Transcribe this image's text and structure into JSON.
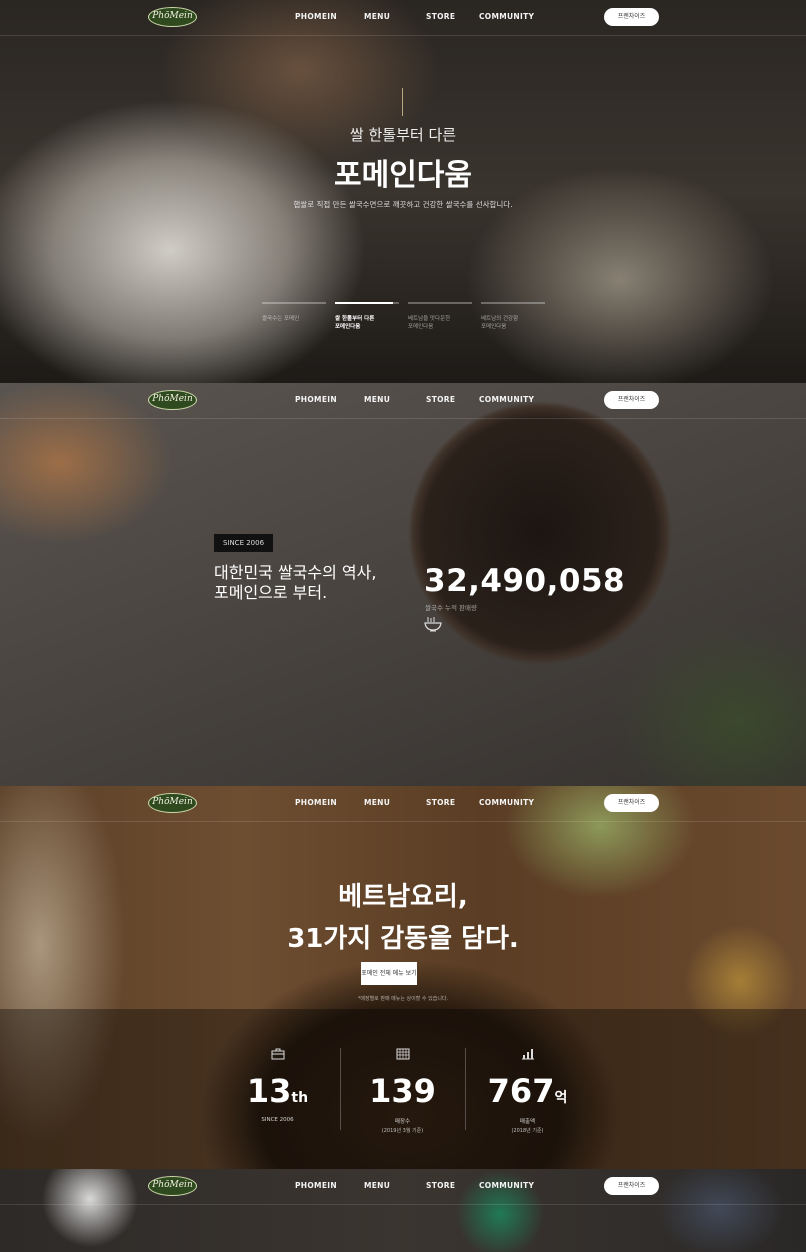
{
  "header": {
    "logo_text": "PhōMein",
    "nav": [
      "PHOMEIN",
      "MENU",
      "STORE",
      "COMMUNITY"
    ],
    "franchise_label": "프랜차이즈"
  },
  "hero": {
    "subtitle": "쌀 한톨부터 다른",
    "title": "포메인다움",
    "description": "햅쌀로 직접 만든 쌀국수면으로 깨끗하고 건강한 쌀국수를 선사합니다.",
    "tabs": [
      {
        "line1": "쌀국수는 포메인",
        "line2": "",
        "progress": 0
      },
      {
        "line1": "쌀 한톨부터 다른",
        "line2": "포메인다움",
        "progress": 0.9
      },
      {
        "line1": "베트남을 맛다운한",
        "line2": "포메인다움",
        "progress": 0
      },
      {
        "line1": "베트남의 건강함",
        "line2": "포메인다움",
        "progress": 0
      }
    ]
  },
  "history": {
    "since_badge": "SINCE 2006",
    "headline_line1": "대한민국 쌀국수의 역사,",
    "headline_line2": "포메인으로 부터.",
    "counter": "32,490,058",
    "counter_label": "쌀국수 누적 판매량"
  },
  "menu_section": {
    "title_line1": "베트남요리,",
    "title_line2": "31가지 감동을 담다.",
    "button_label": "포메인 전체 메뉴 보기",
    "note": "*매장별로 판매 메뉴는 상이할 수 있습니다.",
    "stats": [
      {
        "icon": "briefcase-icon",
        "value": "13",
        "suffix": "th",
        "label": "SINCE 2006",
        "sub": ""
      },
      {
        "icon": "building-icon",
        "value": "139",
        "suffix": "",
        "label": "매장수",
        "sub": "(2019년 3월 기준)"
      },
      {
        "icon": "bar-chart-icon",
        "value": "767",
        "suffix": "억",
        "label": "매출액",
        "sub": "(2018년 기준)"
      }
    ]
  },
  "colors": {
    "logo_green": "#2f4a1f",
    "accent_gold": "#b6a97f",
    "button_bg": "#ffffff"
  }
}
